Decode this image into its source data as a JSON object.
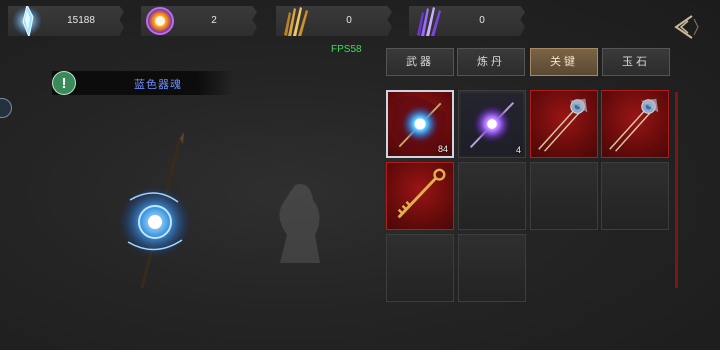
{
  "resources": [
    {
      "icon": "blue-crystal-icon",
      "value": "15188"
    },
    {
      "icon": "orange-orb-icon",
      "value": "2"
    },
    {
      "icon": "golden-claw-icon",
      "value": "0"
    },
    {
      "icon": "purple-claw-icon",
      "value": "0"
    }
  ],
  "fps_label": "FPS58",
  "notice": {
    "icon": "exclamation-icon",
    "text": "蓝色器魂"
  },
  "tabs": [
    {
      "label": "武器",
      "active": false
    },
    {
      "label": "炼丹",
      "active": false
    },
    {
      "label": "关键",
      "active": true
    },
    {
      "label": "玉石",
      "active": false
    }
  ],
  "inventory": [
    {
      "icon": "blue-soul-orb-icon",
      "count": "84",
      "rarity": "red",
      "selected": true
    },
    {
      "icon": "purple-soul-orb-icon",
      "count": "4",
      "rarity": "common",
      "selected": false
    },
    {
      "icon": "ornate-hairpin-icon",
      "count": "",
      "rarity": "red",
      "selected": false
    },
    {
      "icon": "ornate-hairpin-icon",
      "count": "",
      "rarity": "red",
      "selected": false
    },
    {
      "icon": "golden-key-icon",
      "count": "",
      "rarity": "red",
      "selected": false
    },
    {
      "icon": "",
      "count": "",
      "rarity": "empty",
      "selected": false
    },
    {
      "icon": "",
      "count": "",
      "rarity": "empty",
      "selected": false
    },
    {
      "icon": "",
      "count": "",
      "rarity": "empty",
      "selected": false
    },
    {
      "icon": "",
      "count": "",
      "rarity": "empty",
      "selected": false
    },
    {
      "icon": "",
      "count": "",
      "rarity": "empty",
      "selected": false
    }
  ],
  "colors": {
    "accent_gold": "#a88a62",
    "rare_red": "#9a1515",
    "fps_green": "#3ddc5a",
    "notice_blue": "#6f8fff"
  }
}
